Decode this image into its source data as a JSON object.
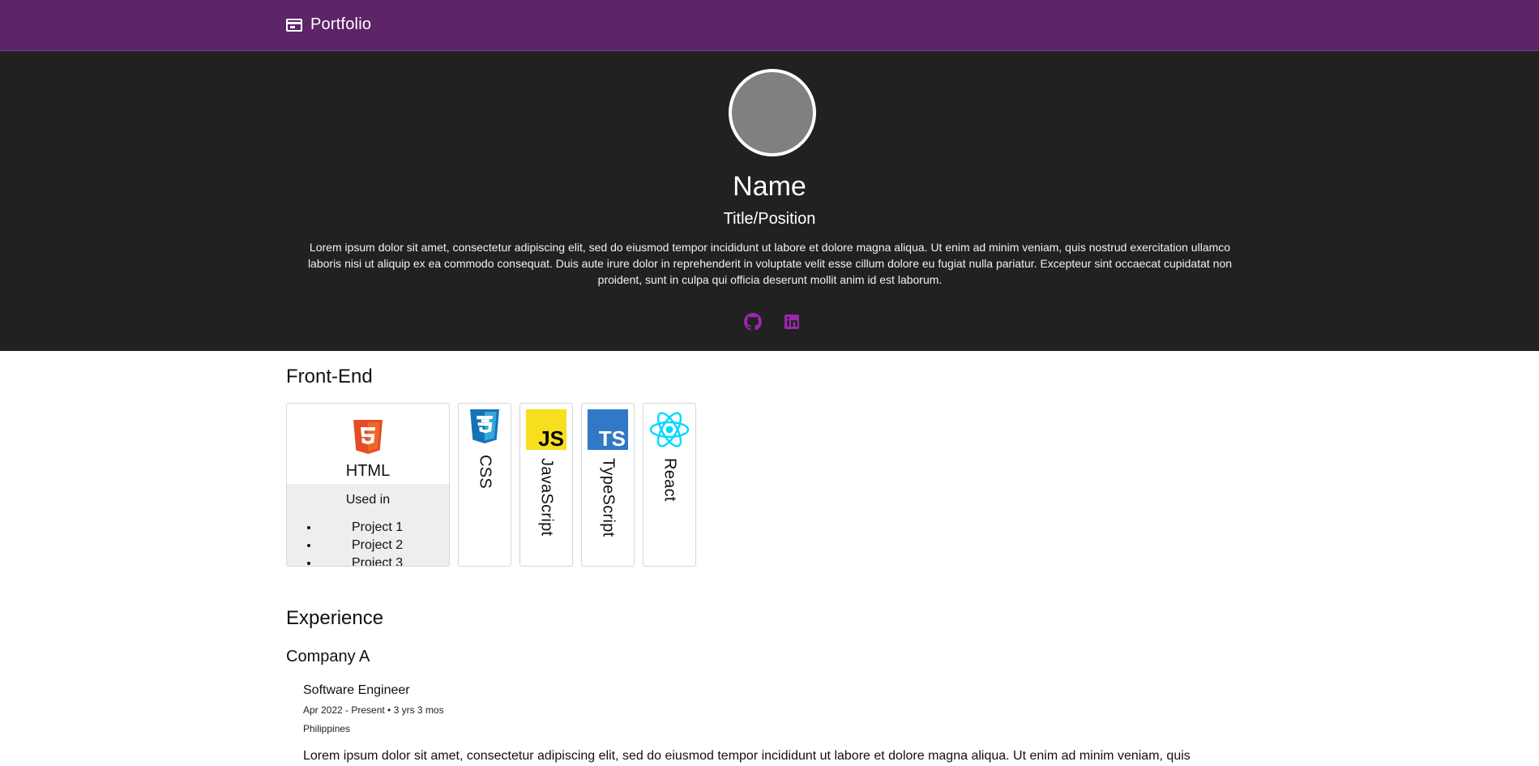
{
  "header": {
    "brand": "Portfolio",
    "brand_icon": "browser-window-icon"
  },
  "profile": {
    "name": "Name",
    "title": "Title/Position",
    "bio": "Lorem ipsum dolor sit amet, consectetur adipiscing elit, sed do eiusmod tempor incididunt ut labore et dolore magna aliqua. Ut enim ad minim veniam, quis nostrud exercitation ullamco laboris nisi ut aliquip ex ea commodo consequat. Duis aute irure dolor in reprehenderit in voluptate velit esse cillum dolore eu fugiat nulla pariatur. Excepteur sint occaecat cupidatat non proident, sunt in culpa qui officia deserunt mollit anim id est laborum.",
    "socials": [
      {
        "icon": "github-icon",
        "color": "#9c27b0"
      },
      {
        "icon": "linkedin-icon",
        "color": "#9c27b0"
      }
    ]
  },
  "frontend": {
    "title": "Front-End",
    "expanded": {
      "name": "HTML",
      "used_in_label": "Used in",
      "projects": [
        "Project 1",
        "Project 2",
        "Project 3"
      ]
    },
    "collapsed": [
      {
        "name": "CSS",
        "icon": "css3-icon"
      },
      {
        "name": "JavaScript",
        "icon": "javascript-icon"
      },
      {
        "name": "TypeScript",
        "icon": "typescript-icon"
      },
      {
        "name": "React",
        "icon": "react-icon"
      }
    ]
  },
  "experience": {
    "title": "Experience",
    "company": "Company A",
    "role": "Software Engineer",
    "period": "Apr 2022 - Present • 3 yrs 3 mos",
    "location": "Philippines",
    "description": "Lorem ipsum dolor sit amet, consectetur adipiscing elit, sed do eiusmod tempor incididunt ut labore et dolore magna aliqua. Ut enim ad minim veniam, quis"
  }
}
